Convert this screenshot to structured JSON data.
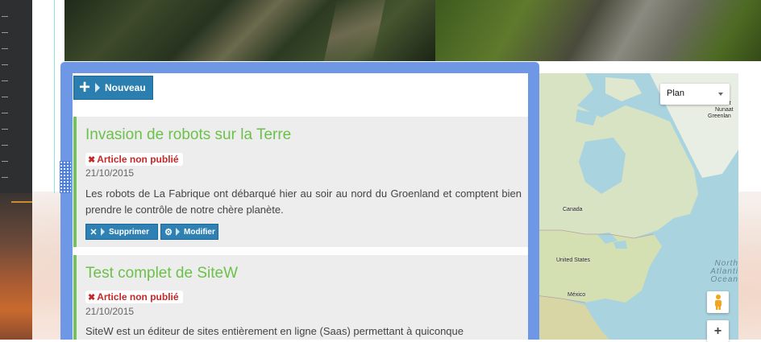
{
  "toolbar": {
    "new_label": "Nouveau",
    "new_icon": "plus-icon"
  },
  "map": {
    "type_select": "Plan",
    "labels": {
      "canada": "Canada",
      "usa": "United States",
      "mexico": "México",
      "nunaat": "Nunaat",
      "greenland": "Greenlan",
      "ullit": "llit"
    },
    "ocean": [
      "North",
      "Atlanti",
      "Ocean"
    ],
    "zoom_in": "+",
    "pegman_icon": "pegman-icon"
  },
  "articles": [
    {
      "title": "Invasion de robots sur la Terre",
      "status": "Article non publié",
      "date": "21/10/2015",
      "body": "Les robots de La Fabrique ont débarqué hier au soir au nord du Groenland et comptent bien prendre le contrôle de notre chère planète.",
      "delete_label": "Supprimer",
      "edit_label": "Modifier"
    },
    {
      "title": "Test complet de SiteW",
      "status": "Article non publié",
      "date": "21/10/2015",
      "body": "SiteW est un éditeur de sites entièrement en ligne (Saas) permettant à quiconque"
    }
  ],
  "colors": {
    "panel": "#6e98e6",
    "title_green": "#6cc14a",
    "button_blue": "#2f80b3",
    "status_red": "#c62828"
  }
}
